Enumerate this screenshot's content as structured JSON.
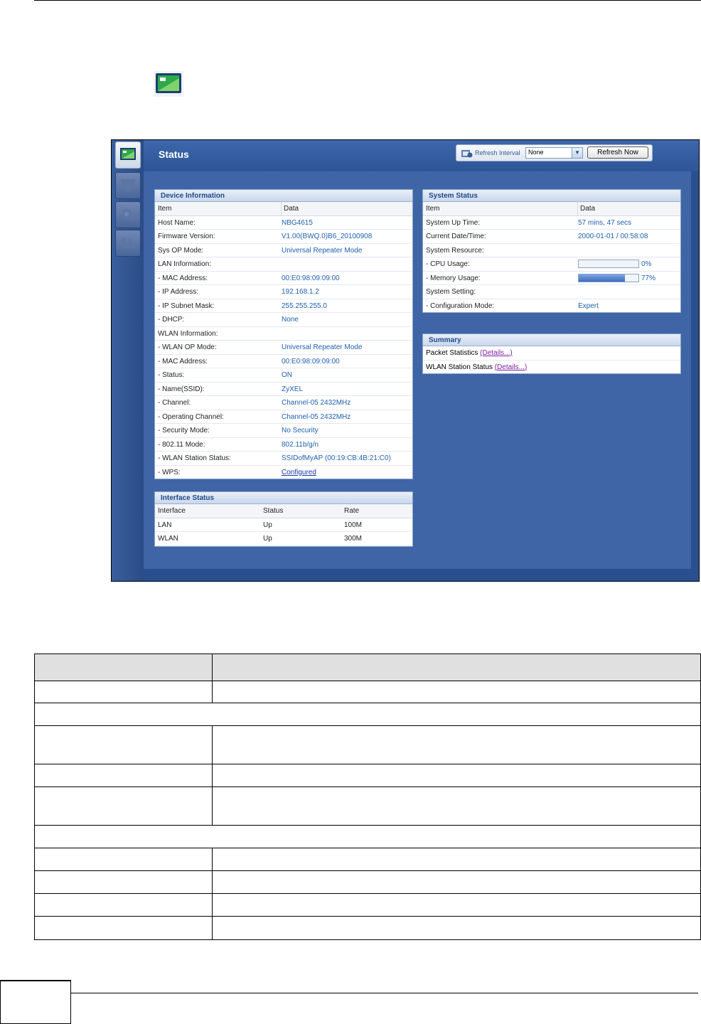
{
  "header": {
    "title": "Status",
    "refresh_label": "Refresh Interval",
    "refresh_value": "None",
    "refresh_button": "Refresh Now"
  },
  "device_info": {
    "title": "Device Information",
    "col_item": "Item",
    "col_data": "Data",
    "rows": [
      {
        "k": "Host Name:",
        "v": "NBG4615"
      },
      {
        "k": "Firmware Version:",
        "v": "V1.00(BWQ.0)B6_20100908"
      },
      {
        "k": "Sys OP Mode:",
        "v": "Universal Repeater Mode"
      },
      {
        "k": "LAN Information:",
        "v": ""
      },
      {
        "k": " - MAC Address:",
        "v": "00:E0:98:09:09:00"
      },
      {
        "k": " - IP Address:",
        "v": "192.168.1.2"
      },
      {
        "k": " - IP Subnet Mask:",
        "v": "255.255.255.0"
      },
      {
        "k": " - DHCP:",
        "v": "None"
      },
      {
        "k": "WLAN Information:",
        "v": ""
      },
      {
        "k": " - WLAN OP Mode:",
        "v": "Universal Repeater Mode"
      },
      {
        "k": " - MAC Address:",
        "v": "00:E0:98:09:09:00"
      },
      {
        "k": " - Status:",
        "v": "ON"
      },
      {
        "k": " - Name(SSID):",
        "v": "ZyXEL"
      },
      {
        "k": " - Channel:",
        "v": "Channel-05 2432MHz"
      },
      {
        "k": " - Operating Channel:",
        "v": "Channel-05 2432MHz"
      },
      {
        "k": " - Security Mode:",
        "v": "No Security"
      },
      {
        "k": " - 802.11 Mode:",
        "v": "802.11b/g/n"
      },
      {
        "k": " - WLAN Station Status:",
        "v": "SSIDofMyAP (00:19:CB:4B:21:C0)"
      },
      {
        "k": " - WPS:",
        "v": "Configured"
      }
    ]
  },
  "interface_status": {
    "title": "Interface Status",
    "cols": [
      "Interface",
      "Status",
      "Rate"
    ],
    "rows": [
      [
        "LAN",
        "Up",
        "100M"
      ],
      [
        "WLAN",
        "Up",
        "300M"
      ]
    ]
  },
  "system_status": {
    "title": "System Status",
    "col_item": "Item",
    "col_data": "Data",
    "up_time_label": "System Up Time:",
    "up_time": "57 mins, 47 secs",
    "datetime_label": "Current Date/Time:",
    "datetime": "2000-01-01 / 00:58:08",
    "resource_label": "System Resource:",
    "cpu_label": " - CPU Usage:",
    "cpu": "0%",
    "cpu_fraction": 0.0,
    "mem_label": " - Memory Usage:",
    "mem": "77%",
    "mem_fraction": 0.77,
    "setting_label": "System Setting:",
    "config_label": " - Configuration Mode:",
    "config": "Expert"
  },
  "summary": {
    "title": "Summary",
    "packet_label": "Packet Statistics",
    "packet_link": "(Details...)",
    "wlan_label": "WLAN Station Status",
    "wlan_link": "(Details...)"
  }
}
